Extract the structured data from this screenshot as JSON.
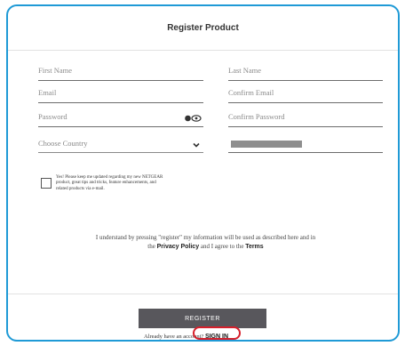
{
  "form": {
    "title": "Register Product",
    "fields": {
      "first_name": "First Name",
      "last_name": "Last Name",
      "email": "Email",
      "confirm_email": "Confirm Email",
      "password": "Password",
      "confirm_password": "Confirm Password",
      "country": "Choose Country"
    }
  },
  "consent": {
    "text": "Yes! Please keep me updated regarding my new NETGEAR product, great tips and tricks, feature enhancements, and related products via e-mail."
  },
  "legal": {
    "prefix": "I understand by pressing \"register\" my information will be used as described here and in the",
    "privacy_link": "Privacy Policy",
    "middle": "and I agree to the",
    "terms_link": "Terms"
  },
  "actions": {
    "register_label": "REGISTER",
    "signin_prompt": "Already have an account?",
    "signin_link": "SIGN IN"
  },
  "colors": {
    "frame_border": "#1f9ad6",
    "button_bg": "#58575c",
    "highlight_ring": "#d61f2b"
  },
  "icons": {
    "password_toggle": "eye-icon",
    "country_dropdown": "chevron-down-icon"
  }
}
